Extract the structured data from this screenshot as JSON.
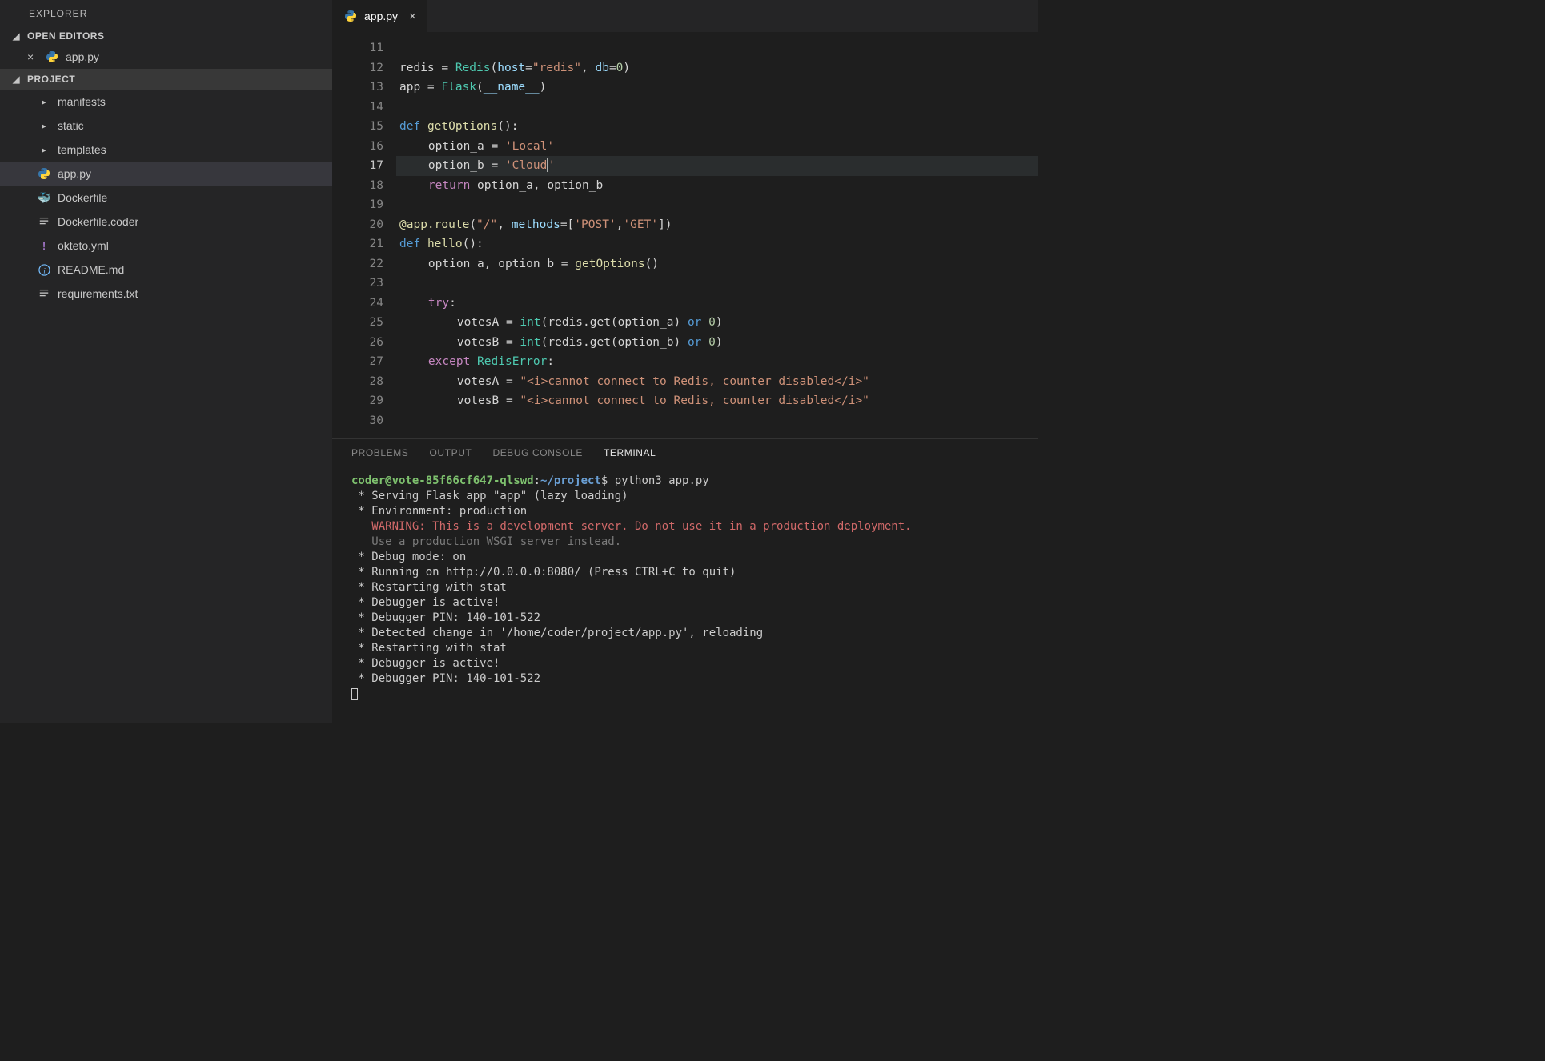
{
  "sidebar": {
    "title": "EXPLORER",
    "openEditorsHeader": "OPEN EDITORS",
    "openEditors": [
      {
        "name": "app.py",
        "icon": "python"
      }
    ],
    "projectHeader": "PROJECT",
    "tree": [
      {
        "name": "manifests",
        "type": "folder"
      },
      {
        "name": "static",
        "type": "folder"
      },
      {
        "name": "templates",
        "type": "folder"
      },
      {
        "name": "app.py",
        "type": "file",
        "icon": "python",
        "selected": true
      },
      {
        "name": "Dockerfile",
        "type": "file",
        "icon": "docker"
      },
      {
        "name": "Dockerfile.coder",
        "type": "file",
        "icon": "lines"
      },
      {
        "name": "okteto.yml",
        "type": "file",
        "icon": "yml"
      },
      {
        "name": "README.md",
        "type": "file",
        "icon": "info"
      },
      {
        "name": "requirements.txt",
        "type": "file",
        "icon": "lines"
      }
    ]
  },
  "tabs": [
    {
      "label": "app.py",
      "icon": "python",
      "active": true
    }
  ],
  "editor": {
    "startLine": 11,
    "activeLine": 17,
    "lines": [
      {
        "n": 11,
        "html": ""
      },
      {
        "n": 12,
        "html": "redis = <span class='cls'>Redis</span>(<span class='var'>host</span>=<span class='str'>\"redis\"</span>, <span class='var'>db</span>=<span class='num'>0</span>)"
      },
      {
        "n": 13,
        "html": "app = <span class='cls'>Flask</span>(<span class='var'>__name__</span>)"
      },
      {
        "n": 14,
        "html": ""
      },
      {
        "n": 15,
        "html": "<span class='kw'>def</span> <span class='fn'>getOptions</span>():"
      },
      {
        "n": 16,
        "html": "<span class='indent-guide'></span>    option_a = <span class='str'>'Local'</span>"
      },
      {
        "n": 17,
        "html": "<span class='indent-guide'></span>    option_b = <span class='str'>'Cloud<span class='cursor'></span>'</span>"
      },
      {
        "n": 18,
        "html": "<span class='indent-guide'></span>    <span class='bl'>return</span> option_a, option_b"
      },
      {
        "n": 19,
        "html": ""
      },
      {
        "n": 20,
        "html": "<span class='dec'>@app.route</span>(<span class='str'>\"/\"</span>, <span class='var'>methods</span>=[<span class='str'>'POST'</span>,<span class='str'>'GET'</span>])"
      },
      {
        "n": 21,
        "html": "<span class='kw'>def</span> <span class='fn'>hello</span>():"
      },
      {
        "n": 22,
        "html": "<span class='indent-guide'></span>    option_a, option_b = <span class='fn'>getOptions</span>()"
      },
      {
        "n": 23,
        "html": "<span class='indent-guide'></span>"
      },
      {
        "n": 24,
        "html": "<span class='indent-guide'></span>    <span class='bl'>try</span>:"
      },
      {
        "n": 25,
        "html": "<span class='indent-guide'></span>    <span class='indent-guide'></span>    votesA = <span class='cls'>int</span>(redis.get(option_a) <span class='kw'>or</span> <span class='num'>0</span>)"
      },
      {
        "n": 26,
        "html": "<span class='indent-guide'></span>    <span class='indent-guide'></span>    votesB = <span class='cls'>int</span>(redis.get(option_b) <span class='kw'>or</span> <span class='num'>0</span>)"
      },
      {
        "n": 27,
        "html": "<span class='indent-guide'></span>    <span class='bl'>except</span> <span class='cls'>RedisError</span>:"
      },
      {
        "n": 28,
        "html": "<span class='indent-guide'></span>    <span class='indent-guide'></span>    votesA = <span class='str'>\"&lt;i&gt;cannot connect to Redis, counter disabled&lt;/i&gt;\"</span>"
      },
      {
        "n": 29,
        "html": "<span class='indent-guide'></span>    <span class='indent-guide'></span>    votesB = <span class='str'>\"&lt;i&gt;cannot connect to Redis, counter disabled&lt;/i&gt;\"</span>"
      },
      {
        "n": 30,
        "html": ""
      }
    ]
  },
  "panel": {
    "tabs": [
      "PROBLEMS",
      "OUTPUT",
      "DEBUG CONSOLE",
      "TERMINAL"
    ],
    "activeTab": "TERMINAL",
    "terminal": {
      "promptUser": "coder@vote-85f66cf647-qlswd",
      "promptPath": "~/project",
      "command": "python3 app.py",
      "lines": [
        " * Serving Flask app \"app\" (lazy loading)",
        " * Environment: production"
      ],
      "warning": "   WARNING: This is a development server. Do not use it in a production deployment.",
      "dim": "   Use a production WSGI server instead.",
      "lines2": [
        " * Debug mode: on",
        " * Running on http://0.0.0.0:8080/ (Press CTRL+C to quit)",
        " * Restarting with stat",
        " * Debugger is active!",
        " * Debugger PIN: 140-101-522",
        " * Detected change in '/home/coder/project/app.py', reloading",
        " * Restarting with stat",
        " * Debugger is active!",
        " * Debugger PIN: 140-101-522"
      ]
    }
  }
}
